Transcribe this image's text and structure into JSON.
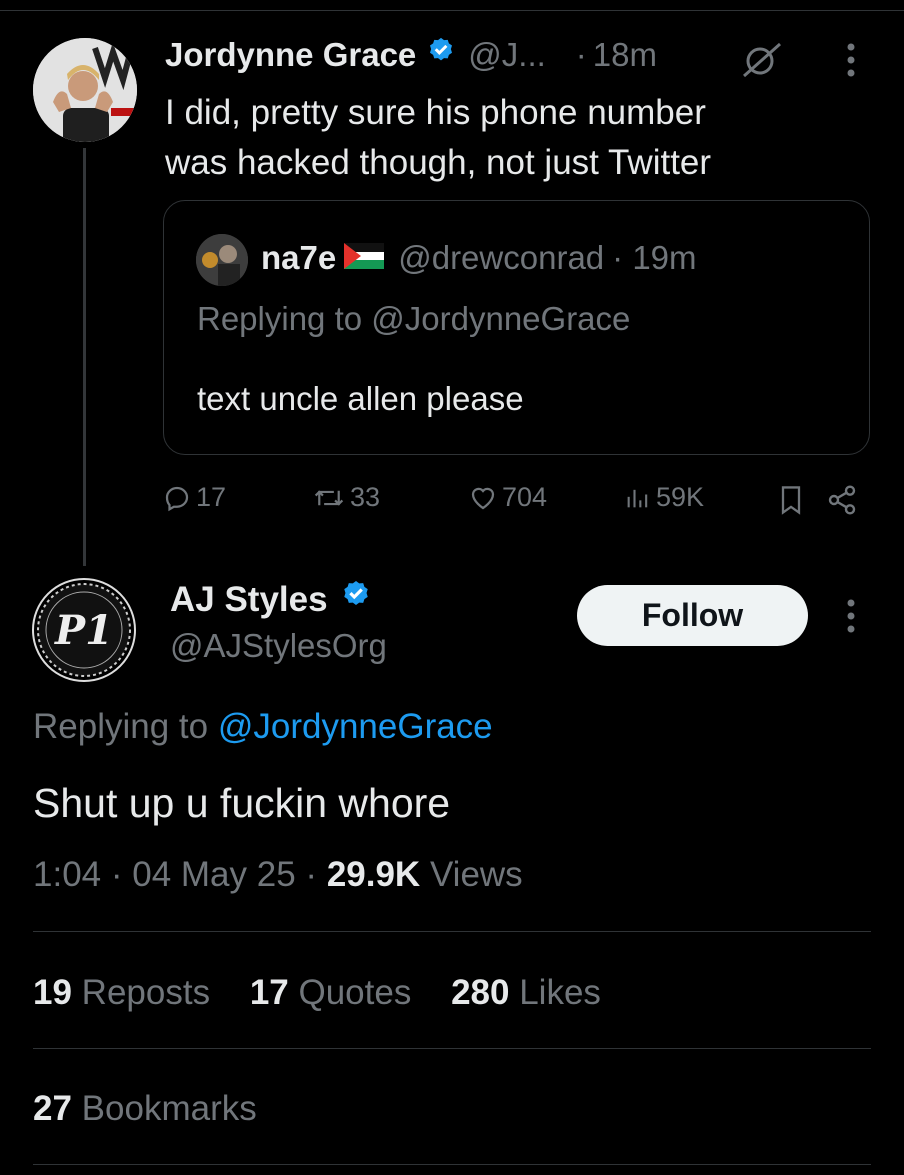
{
  "reply_tweet": {
    "author_name": "Jordynne Grace",
    "author_handle": "@J...",
    "dot": "·",
    "time": "18m",
    "text_line1": "I did, pretty sure his phone number",
    "text_line2": "was hacked though, not just Twitter"
  },
  "quoted_tweet": {
    "author_name": "na7e",
    "author_handle": "@drewconrad",
    "time": "· 19m",
    "replying_prefix": "Replying to ",
    "replying_handle": "@JordynneGrace",
    "text": "text uncle allen please"
  },
  "reply_actions": {
    "replies": "17",
    "reposts": "33",
    "likes": "704",
    "views": "59K"
  },
  "main_tweet": {
    "author_name": "AJ Styles",
    "author_handle": "@AJStylesOrg",
    "follow_label": "Follow",
    "replying_prefix": "Replying to ",
    "replying_handle": "@JordynneGrace",
    "text": "Shut up u fuckin whore",
    "time": "1:04",
    "date": "04 May 25",
    "sep": "·",
    "views_count": "29.9K",
    "views_label": "Views"
  },
  "stats": {
    "reposts_count": "19",
    "reposts_label": "Reposts",
    "quotes_count": "17",
    "quotes_label": "Quotes",
    "likes_count": "280",
    "likes_label": "Likes",
    "bookmarks_count": "27",
    "bookmarks_label": "Bookmarks"
  },
  "colors": {
    "background": "#000000",
    "text": "#e7e9ea",
    "muted": "#71767b",
    "link": "#1d9bf0",
    "verified": "#1d9bf0",
    "border": "#2f3336"
  },
  "icons": {
    "verified": "verified-badge-icon",
    "grok": "grok-icon",
    "more": "more-vertical-icon",
    "reply": "reply-icon",
    "repost": "repost-icon",
    "like": "heart-icon",
    "views": "views-icon",
    "bookmark": "bookmark-icon",
    "share": "share-icon",
    "flag": "palestine-flag-icon"
  }
}
